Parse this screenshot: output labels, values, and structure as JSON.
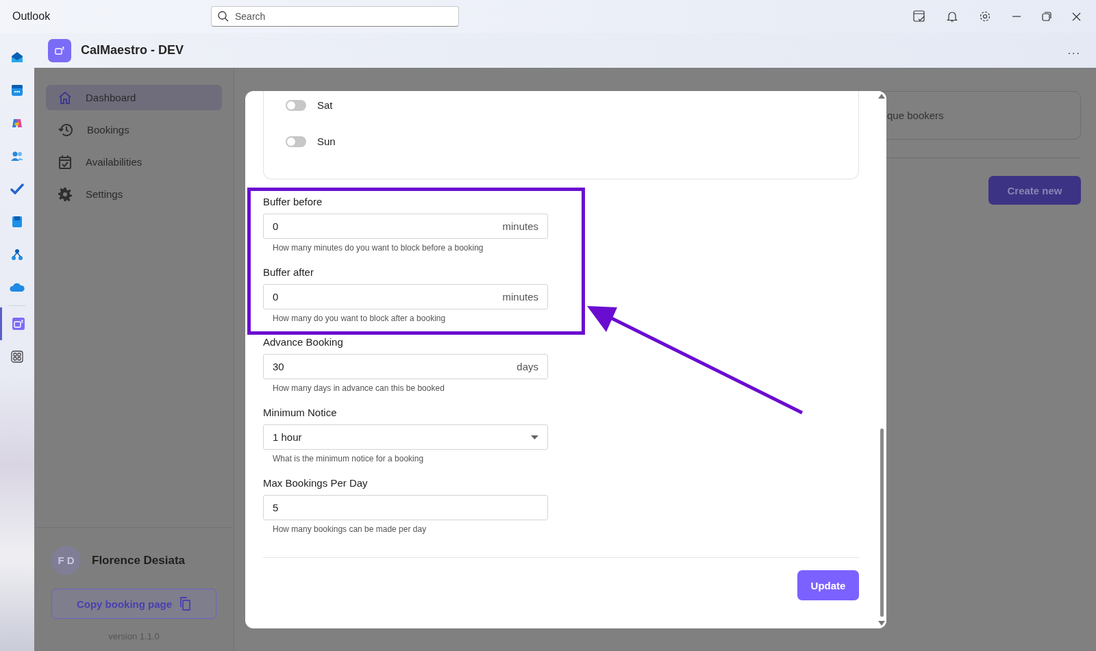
{
  "window": {
    "title": "Outlook",
    "search": {
      "placeholder": "Search"
    }
  },
  "rail": [
    {
      "kind": "mail",
      "selected": false
    },
    {
      "kind": "calendar",
      "selected": false
    },
    {
      "kind": "copilot",
      "selected": false
    },
    {
      "kind": "people",
      "selected": false
    },
    {
      "kind": "todo",
      "selected": false
    },
    {
      "kind": "notebook",
      "selected": false
    },
    {
      "kind": "org",
      "selected": false
    },
    {
      "kind": "cloud",
      "selected": false
    },
    {
      "kind": "app",
      "selected": true
    },
    {
      "kind": "apps",
      "selected": false
    }
  ],
  "app": {
    "title": "CalMaestro - DEV",
    "more": "..."
  },
  "sidebar": {
    "items": [
      {
        "kind": "home",
        "label": "Dashboard",
        "selected": true
      },
      {
        "kind": "history",
        "label": "Bookings",
        "selected": false
      },
      {
        "kind": "calendar",
        "label": "Availabilities",
        "selected": false
      },
      {
        "kind": "gear",
        "label": "Settings",
        "selected": false
      }
    ],
    "user": {
      "initials": "F D",
      "name": "Florence Desiata"
    },
    "copy_button": "Copy booking page",
    "version": "version 1.1.0"
  },
  "background": {
    "card_text": "que bookers",
    "create_button": "Create new"
  },
  "modal": {
    "days": [
      {
        "label": "Sat",
        "on": false
      },
      {
        "label": "Sun",
        "on": false
      }
    ],
    "fields": [
      {
        "kind": "unit",
        "label": "Buffer before",
        "value": "0",
        "unit": "minutes",
        "help": "How many minutes do you want to block before a booking",
        "highlighted": true
      },
      {
        "kind": "unit",
        "label": "Buffer after",
        "value": "0",
        "unit": "minutes",
        "help": "How many do you want to block after a booking",
        "highlighted": true
      },
      {
        "kind": "unit",
        "label": "Advance Booking",
        "value": "30",
        "unit": "days",
        "help": "How many days in advance can this be booked",
        "highlighted": false
      },
      {
        "kind": "select",
        "label": "Minimum Notice",
        "value": "1 hour",
        "help": "What is the minimum notice for a booking",
        "highlighted": false
      },
      {
        "kind": "plain",
        "label": "Max Bookings Per Day",
        "value": "5",
        "help": "How many bookings can be made per day",
        "highlighted": false
      }
    ],
    "update_button": "Update"
  }
}
